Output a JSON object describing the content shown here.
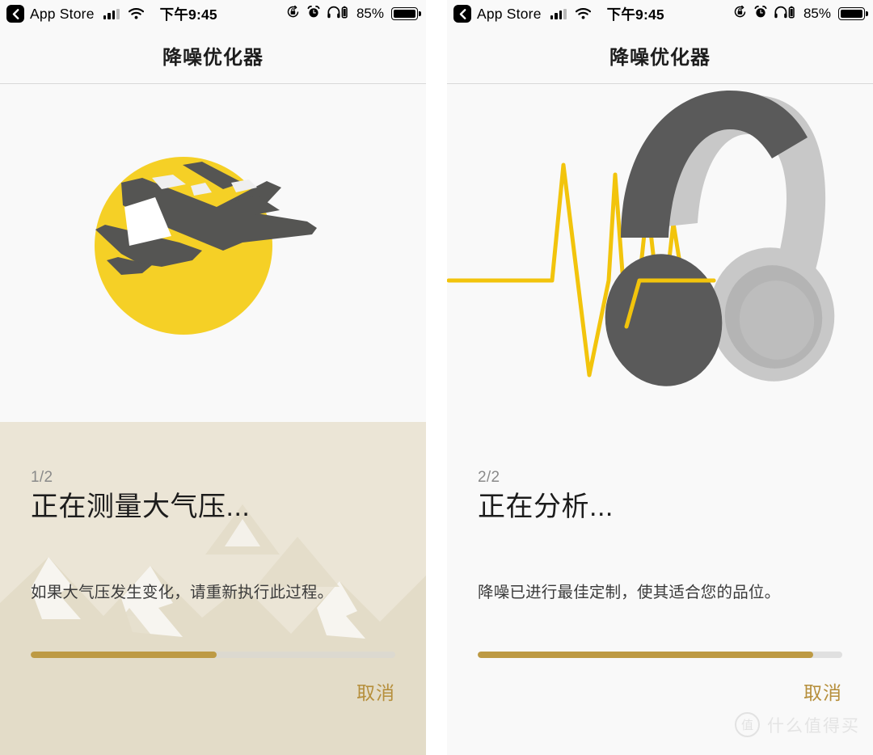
{
  "status_bar": {
    "back_app": "App Store",
    "time": "下午9:45",
    "battery_percent": "85%",
    "icons": [
      "back-chevron-icon",
      "cellular-signal-icon",
      "wifi-icon",
      "rotation-lock-icon",
      "alarm-clock-icon",
      "headphones-battery-icon",
      "battery-icon"
    ]
  },
  "nav": {
    "title": "降噪优化器"
  },
  "panels": [
    {
      "artwork": "airplane-in-sun-illustration",
      "background_art": "mountain-range-illustration",
      "step_count": "1/2",
      "headline": "正在测量大气压...",
      "subtitle": "如果大气压发生变化，请重新执行此过程。",
      "progress_percent": 51,
      "cancel_label": "取消"
    },
    {
      "artwork": "headphones-with-waveform-illustration",
      "background_art": "none",
      "step_count": "2/2",
      "headline": "正在分析...",
      "subtitle": "降噪已进行最佳定制，使其适合您的品位。",
      "progress_percent": 92,
      "cancel_label": "取消"
    }
  ],
  "watermark": {
    "badge": "值",
    "text": "什么值得买"
  },
  "colors": {
    "accent_gold": "#bd9a44",
    "cancel_gold": "#b68f3c",
    "sun_yellow": "#f5d026",
    "waveform_yellow": "#f2c40c",
    "headphone_dark": "#5a5a5a",
    "headphone_light": "#c8c8c8",
    "left_panel_tint": "#ebe5d6",
    "mountain_tan": "#e3dcc8",
    "panel_bg": "#f9f9f9",
    "track_gray": "#dcd9d0"
  }
}
